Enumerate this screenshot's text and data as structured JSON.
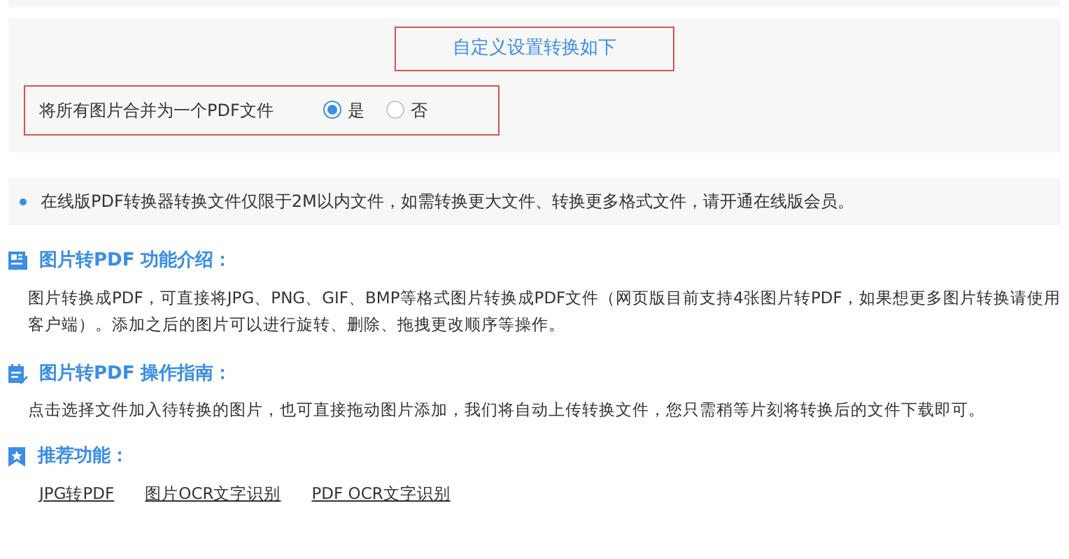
{
  "settings": {
    "title": "自定义设置转换如下",
    "title_highlighted": true,
    "option": {
      "label": "将所有图片合并为一个PDF文件",
      "highlighted": true,
      "choices": [
        {
          "label": "是",
          "selected": true
        },
        {
          "label": "否",
          "selected": false
        }
      ]
    }
  },
  "notice": "在线版PDF转换器转换文件仅限于2M以内文件，如需转换更大文件、转换更多格式文件，请开通在线版会员。",
  "sections": [
    {
      "kind": "intro",
      "heading": "图片转PDF 功能介绍：",
      "text": "图片转换成PDF，可直接将JPG、PNG、GIF、BMP等格式图片转换成PDF文件（网页版目前支持4张图片转PDF，如果想更多图片转换请使用客户端）。添加之后的图片可以进行旋转、删除、拖拽更改顺序等操作。"
    },
    {
      "kind": "guide",
      "heading": "图片转PDF 操作指南：",
      "text": "点击选择文件加入待转换的图片，也可直接拖动图片添加，我们将自动上传转换文件，您只需稍等片刻将转换后的文件下载即可。"
    },
    {
      "kind": "recommend",
      "heading": "推荐功能：",
      "links": [
        "JPG转PDF",
        "图片OCR文字识别",
        "PDF OCR文字识别"
      ]
    }
  ]
}
